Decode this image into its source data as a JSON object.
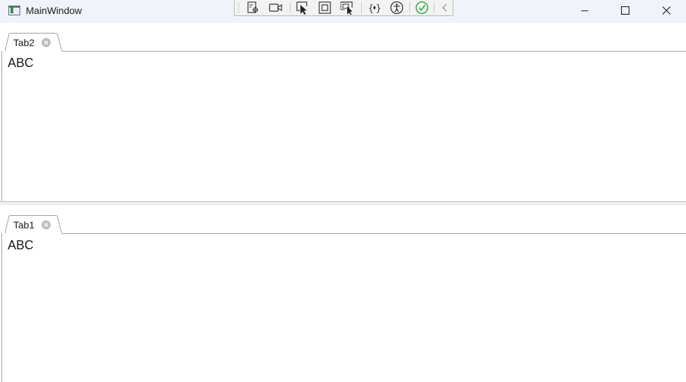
{
  "window": {
    "title": "MainWindow",
    "icon": "app-window-icon"
  },
  "window_controls": {
    "minimize_icon": "minimize-icon",
    "maximize_icon": "maximize-icon",
    "close_icon": "close-icon"
  },
  "debug_toolbar": {
    "buttons": [
      "live-visual-tree-icon",
      "video-camera-icon",
      "select-element-icon",
      "display-layout-adorners-icon",
      "track-focused-element-icon",
      "binding-failures-icon",
      "accessibility-icon",
      "checkmark-icon",
      "collapse-chevron-icon"
    ],
    "accent_color": "#2ba83b"
  },
  "panes": [
    {
      "tab_label": "Tab2",
      "content": "ABC"
    },
    {
      "tab_label": "Tab1",
      "content": "ABC"
    }
  ]
}
